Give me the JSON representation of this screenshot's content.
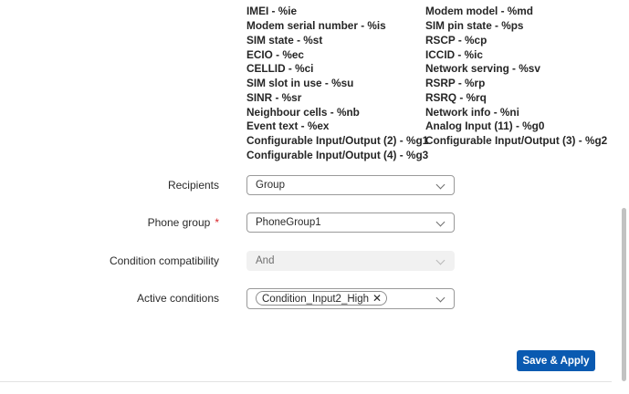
{
  "variables": {
    "left": [
      "IMEI - %ie",
      "Modem serial number - %is",
      "SIM state - %st",
      "ECIO - %ec",
      "CELLID - %ci",
      "SIM slot in use - %su",
      "SINR - %sr",
      "Neighbour cells - %nb",
      "Event text - %ex",
      "Configurable Input/Output (2) - %g1",
      "Configurable Input/Output (4) - %g3"
    ],
    "right": [
      "Modem model - %md",
      "SIM pin state - %ps",
      "RSCP - %cp",
      "ICCID - %ic",
      "Network serving - %sv",
      "RSRP - %rp",
      "RSRQ - %rq",
      "Network info - %ni",
      "Analog Input (11) - %g0",
      "Configurable Input/Output (3) - %g2"
    ]
  },
  "form": {
    "recipients": {
      "label": "Recipients",
      "value": "Group"
    },
    "phone_group": {
      "label": "Phone group",
      "required_mark": "*",
      "value": "PhoneGroup1"
    },
    "condition_compatibility": {
      "label": "Condition compatibility",
      "value": "And"
    },
    "active_conditions": {
      "label": "Active conditions",
      "chip": "Condition_Input2_High",
      "chip_remove": "✕"
    }
  },
  "buttons": {
    "save_apply": "Save & Apply"
  },
  "colors": {
    "primary": "#0a5ab1",
    "required": "#d9262b"
  }
}
